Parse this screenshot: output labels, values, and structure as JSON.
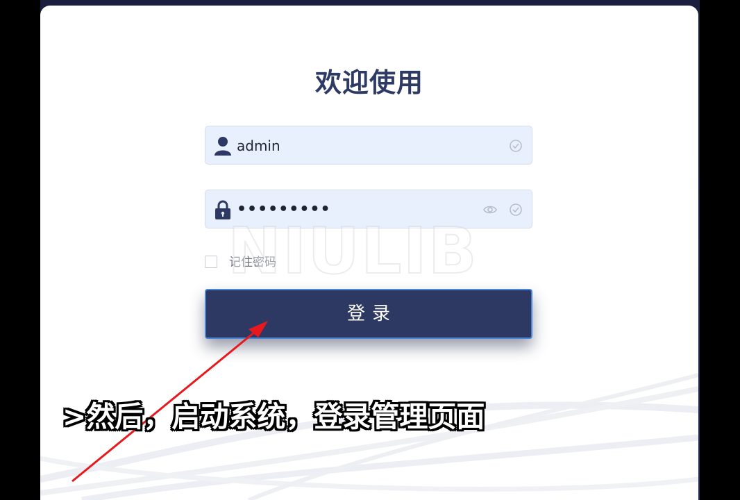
{
  "login": {
    "title": "欢迎使用",
    "username": {
      "value": "admin"
    },
    "password": {
      "value": "•••••••••"
    },
    "remember_label": "记住密码",
    "remember_checked": false,
    "submit_label": "登录"
  },
  "overlay": {
    "watermark": "NIULIB",
    "caption": ">然后，启动系统，登录管理页面",
    "arrow_color": "#e8191e"
  },
  "colors": {
    "primary": "#2d3963",
    "input_bg": "#e8f0fe",
    "title": "#2d3a63"
  }
}
